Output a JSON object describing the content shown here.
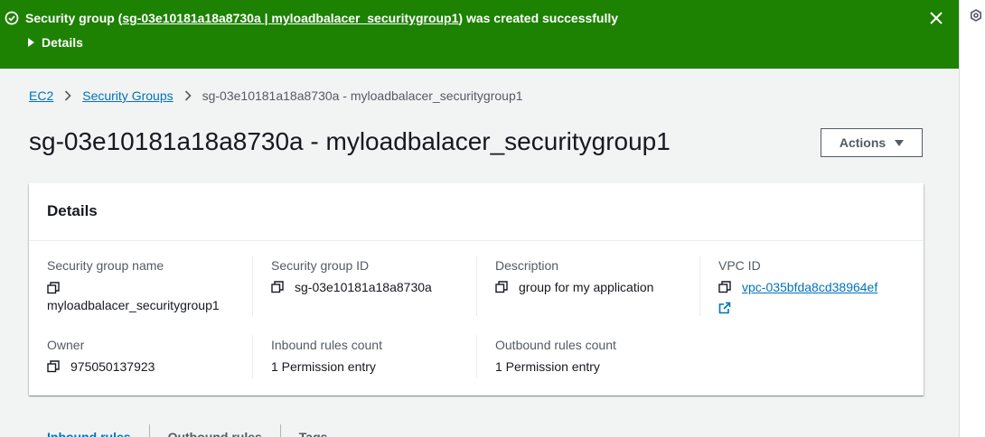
{
  "flash": {
    "prefix": "Security group (",
    "link": "sg-03e10181a18a8730a | myloadbalacer_securitygroup1",
    "suffix": ") was created successfully",
    "details_label": "Details",
    "color": "#1d8102"
  },
  "breadcrumb": {
    "items": [
      "EC2",
      "Security Groups"
    ],
    "current": "sg-03e10181a18a8730a - myloadbalacer_securitygroup1"
  },
  "page_title": "sg-03e10181a18a8730a - myloadbalacer_securitygroup1",
  "actions_label": "Actions",
  "details": {
    "title": "Details",
    "fields": {
      "sg_name": {
        "label": "Security group name",
        "value": "myloadbalacer_securitygroup1"
      },
      "sg_id": {
        "label": "Security group ID",
        "value": "sg-03e10181a18a8730a"
      },
      "description": {
        "label": "Description",
        "value": "group for my application"
      },
      "vpc_id": {
        "label": "VPC ID",
        "value": "vpc-035bfda8cd38964ef"
      },
      "owner": {
        "label": "Owner",
        "value": "975050137923"
      },
      "inbound": {
        "label": "Inbound rules count",
        "value": "1 Permission entry"
      },
      "outbound": {
        "label": "Outbound rules count",
        "value": "1 Permission entry"
      }
    }
  },
  "tabs": [
    "Inbound rules",
    "Outbound rules",
    "Tags"
  ],
  "colors": {
    "link": "#0073bb",
    "success": "#1d8102",
    "text": "#16191f",
    "secondary": "#545b64"
  }
}
